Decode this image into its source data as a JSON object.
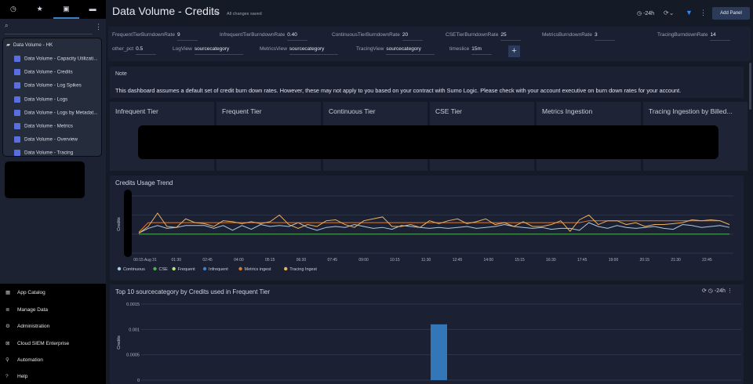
{
  "sidebar": {
    "nav_icons": [
      "clock-icon",
      "star-icon",
      "library-icon",
      "folder-icon"
    ],
    "folder": "Data Volume - HK",
    "items": [
      "Data Volume - Capacity Utilizati...",
      "Data Volume - Credits",
      "Data Volume - Log Spikes",
      "Data Volume - Logs",
      "Data Volume - Logs by Metadat...",
      "Data Volume - Metrics",
      "Data Volume - Overview",
      "Data Volume - Tracing"
    ],
    "bottom": [
      {
        "label": "App Catalog",
        "icon": "grid-icon"
      },
      {
        "label": "Manage Data",
        "icon": "database-icon"
      },
      {
        "label": "Administration",
        "icon": "gear-icon"
      },
      {
        "label": "Cloud SIEM Enterprise",
        "icon": "siem-icon"
      },
      {
        "label": "Automation",
        "icon": "automation-icon"
      },
      {
        "label": "Help",
        "icon": "help-icon"
      }
    ]
  },
  "header": {
    "title": "Data Volume - Credits",
    "saved": "All changes saved",
    "time_range": "-24h",
    "add_panel": "Add Panel"
  },
  "params": [
    {
      "label": "FrequentTierBurndownRate",
      "value": "9"
    },
    {
      "label": "InfrequentTierBurndownRate",
      "value": "0.40"
    },
    {
      "label": "ContinuousTierBurndownRate",
      "value": "20"
    },
    {
      "label": "CSETierBurndownRate",
      "value": "25"
    },
    {
      "label": "MetricsBurndownRate",
      "value": "3"
    },
    {
      "label": "TracingBurndownRate",
      "value": "14"
    },
    {
      "label": "other_pct",
      "value": "0.5"
    },
    {
      "label": "LogView",
      "value": "sourcecategory"
    },
    {
      "label": "MetricsView",
      "value": "sourcecategory"
    },
    {
      "label": "TracingView",
      "value": "sourcecategory"
    },
    {
      "label": "timeslice",
      "value": "15m"
    }
  ],
  "add_param": "+",
  "note": {
    "title": "Note",
    "text": "This dashboard assumes a default set of credit burn down rates. However, these may not apply to you based on your contract with Sumo Logic. Please check with your account executive on burn down rates for your account."
  },
  "tiles": [
    "Infrequent Tier",
    "Frequent Tier",
    "Continuous Tier",
    "CSE Tier",
    "Metrics Ingestion",
    "Tracing Ingestion by Billed..."
  ],
  "chart_data": [
    {
      "type": "line",
      "title": "Credits Usage Trend",
      "ylabel": "Credits",
      "xlabel": "",
      "x_ticks": [
        "00:15 Aug 31",
        "01:30",
        "02:45",
        "04:00",
        "05:15",
        "06:30",
        "07:45",
        "09:00",
        "10:15",
        "11:30",
        "12:45",
        "14:00",
        "15:15",
        "16:30",
        "17:45",
        "19:00",
        "20:15",
        "21:30",
        "22:45"
      ],
      "grid": true,
      "legend": "bottom-left",
      "series": [
        {
          "name": "Continuous",
          "color": "#a9c9e3",
          "values": [
            1.05,
            1.3,
            1.45,
            1.3,
            1.35,
            1.45,
            1.45,
            1.45,
            1.3,
            1.45,
            1.2,
            1.45,
            1.25,
            1.5,
            1.4,
            1.45,
            1.4,
            1.6,
            1.35,
            1.2,
            1.35,
            1.4,
            1.35,
            1.5,
            1.4,
            1.3,
            1.35,
            1.25,
            1.45,
            1.4,
            1.35,
            1.3,
            1.35,
            1.3,
            1.35,
            1.4,
            1.3,
            1.35,
            1.4,
            1.5,
            1.4,
            1.35,
            1.3,
            1.35,
            1.25,
            1.3,
            1.3,
            1.2,
            1.6,
            1.4,
            1.3,
            1.45,
            1.35,
            1.3,
            1.35,
            1.4,
            1.3,
            1.25,
            1.5,
            1.45,
            1.35,
            1.4,
            1.45,
            1.35
          ]
        },
        {
          "name": "CSE",
          "color": "#4caf50",
          "values": [
            1,
            1,
            1,
            1,
            1,
            1,
            1,
            1,
            1,
            1,
            1,
            1,
            1,
            1,
            1,
            1,
            1,
            1,
            1,
            1,
            1,
            1,
            1,
            1,
            1,
            1,
            1,
            1,
            1,
            1,
            1,
            1,
            1,
            1,
            1,
            1,
            1,
            1,
            1,
            1,
            1,
            1,
            1,
            1,
            1,
            1,
            1,
            1,
            1,
            1,
            1,
            1,
            1,
            1,
            1,
            1,
            1,
            1,
            1,
            1,
            1,
            1,
            1,
            1
          ]
        },
        {
          "name": "Frequent",
          "color": "#b5e07a",
          "values": []
        },
        {
          "name": "Infrequent",
          "color": "#3b82c4",
          "values": []
        },
        {
          "name": "Metrics ingest",
          "color": "#e07b2e",
          "values": [
            1.1,
            1.6,
            1.6,
            1.6,
            1.6,
            1.6,
            1.6,
            1.6,
            1.6,
            1.6,
            1.6,
            1.6,
            1.6,
            1.6,
            1.6,
            1.6,
            1.6,
            1.6,
            1.6,
            1.6,
            1.6,
            1.6,
            1.6,
            1.6,
            1.6,
            1.6,
            1.6,
            1.6,
            1.6,
            1.6,
            1.6,
            1.6,
            1.6,
            1.6,
            1.6,
            1.6,
            1.6,
            1.6,
            1.6,
            1.6,
            1.6,
            1.6,
            1.6,
            1.6,
            1.6,
            1.6,
            1.6,
            1.6,
            1.7,
            1.7,
            1.7,
            1.7,
            1.7,
            1.7,
            1.7,
            1.7,
            1.7,
            1.7,
            1.7,
            1.7,
            1.7,
            1.7,
            1.7,
            1.5
          ]
        },
        {
          "name": "Tracing Ingest",
          "color": "#f0b060",
          "values": [
            1.05,
            1.4,
            2.1,
            1.4,
            1.35,
            1.8,
            1.6,
            1.55,
            1.4,
            1.7,
            1.65,
            1.55,
            1.65,
            1.55,
            1.65,
            2.0,
            1.5,
            1.3,
            1.5,
            1.4,
            1.7,
            1.75,
            1.5,
            1.35,
            1.7,
            1.8,
            1.9,
            1.4,
            1.4,
            1.5,
            1.35,
            1.7,
            1.55,
            1.7,
            1.8,
            1.55,
            1.65,
            1.8,
            1.5,
            1.6,
            1.4,
            1.65,
            1.4,
            1.4,
            1.5,
            1.7,
            1.15,
            1.75,
            2.0,
            1.5,
            1.7,
            1.7,
            1.5,
            1.6,
            1.4,
            1.5,
            1.5,
            1.55,
            1.6,
            1.75,
            1.7,
            1.75,
            1.7,
            1.5
          ]
        }
      ]
    },
    {
      "type": "bar",
      "title": "Top 10 sourcecategory by Credits used in Frequent Tier",
      "ylabel": "Credits",
      "y_ticks": [
        "0.0015",
        "0.001",
        "0.0005",
        "0"
      ],
      "ylim": [
        0,
        0.0015
      ],
      "values": [
        0.0011
      ],
      "color": "#3377b8",
      "time_range": "-24h"
    }
  ]
}
